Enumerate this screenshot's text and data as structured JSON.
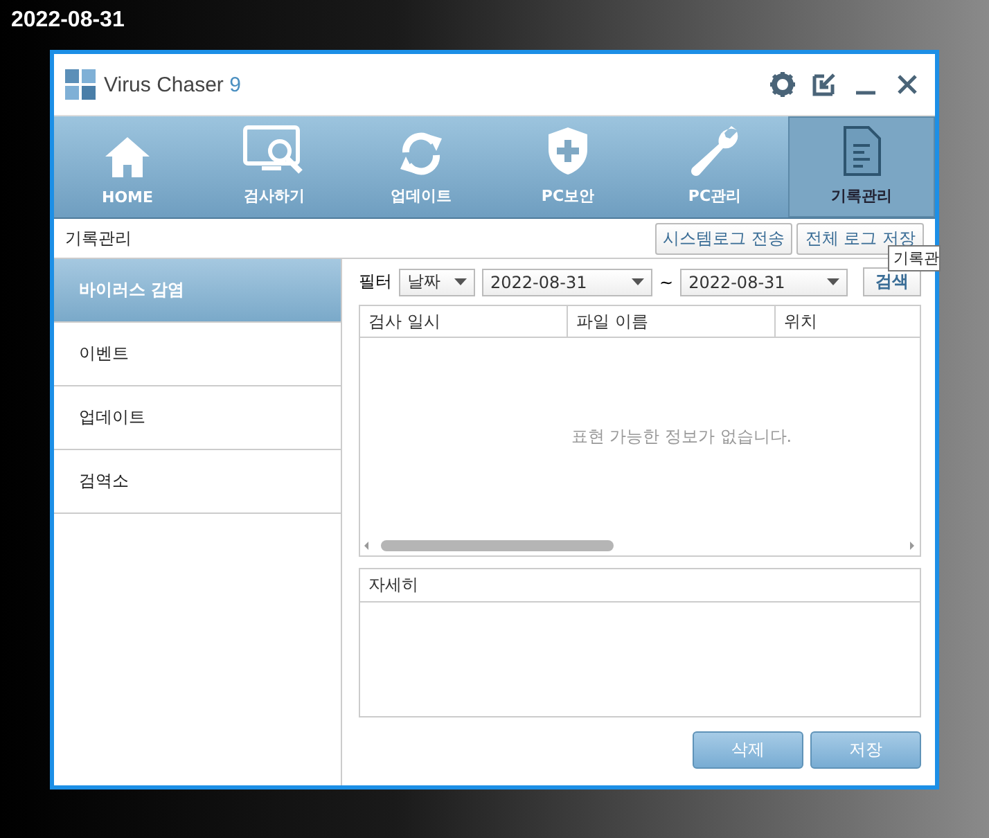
{
  "caption": "2022-08-31",
  "window": {
    "title": "Virus Chaser",
    "version": "9"
  },
  "nav_tabs": [
    {
      "label": "HOME",
      "selected": false
    },
    {
      "label": "검사하기",
      "selected": false
    },
    {
      "label": "업데이트",
      "selected": false
    },
    {
      "label": "PC보안",
      "selected": false
    },
    {
      "label": "PC관리",
      "selected": false
    },
    {
      "label": "기록관리",
      "selected": true
    }
  ],
  "section_title": "기록관리",
  "header_buttons": [
    "시스템로그 전송",
    "전체 로그 저장"
  ],
  "tooltip": "기록관",
  "sidebar": {
    "items": [
      {
        "label": "바이러스 감염",
        "selected": true
      },
      {
        "label": "이벤트",
        "selected": false
      },
      {
        "label": "업데이트",
        "selected": false
      },
      {
        "label": "검역소",
        "selected": false
      }
    ]
  },
  "filter": {
    "label": "필터",
    "type": "날짜",
    "from": "2022-08-31",
    "separator": "~",
    "to": "2022-08-31",
    "search_button": "검색"
  },
  "table": {
    "columns": [
      "검사 일시",
      "파일 이름",
      "위치"
    ],
    "empty_message": "표현 가능한 정보가 없습니다."
  },
  "details": {
    "title": "자세히"
  },
  "buttons": [
    "삭제",
    "저장"
  ]
}
